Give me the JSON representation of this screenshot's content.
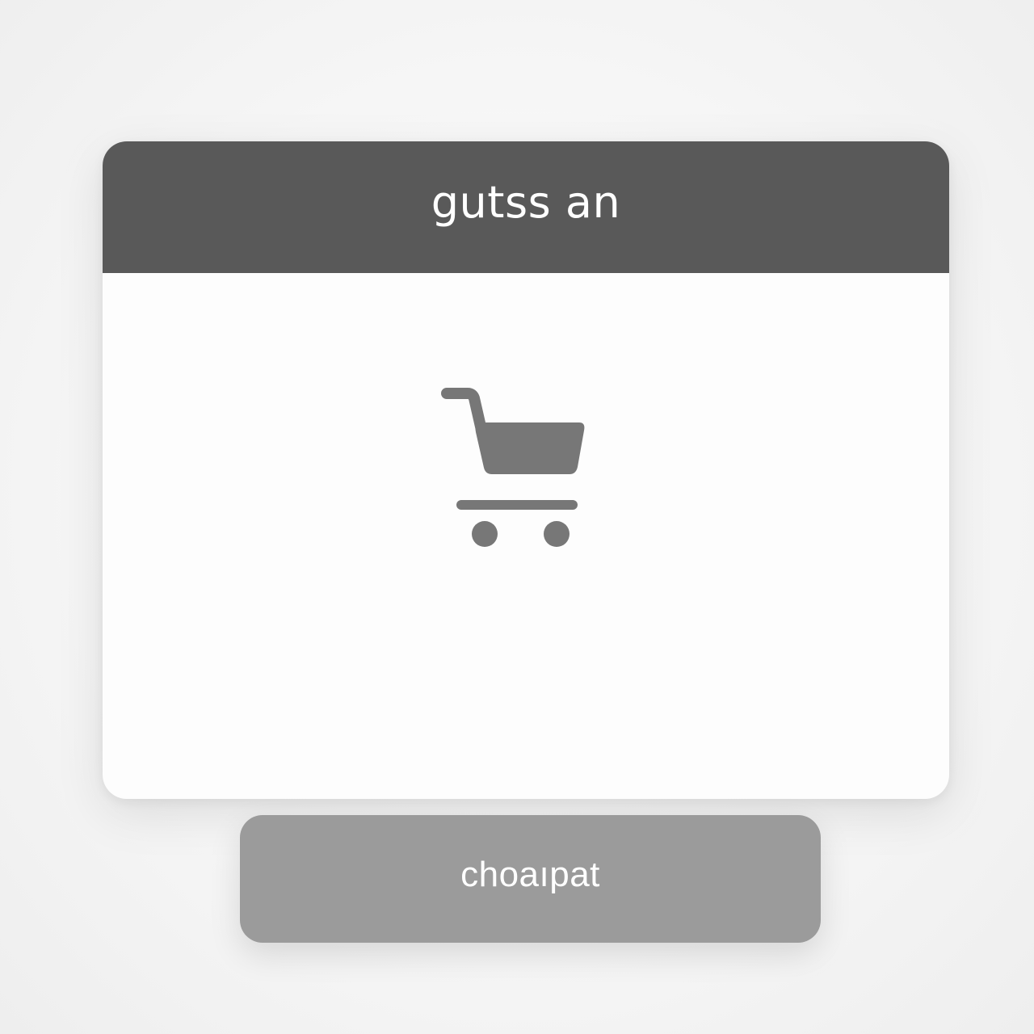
{
  "dialog": {
    "title": "gutss an",
    "icon": "shopping-cart-icon",
    "colors": {
      "header_bg": "#595959",
      "body_bg": "#fdfdfd",
      "icon": "#777777"
    }
  },
  "action_button": {
    "label": "choaıpat",
    "color": "#9b9b9b"
  }
}
